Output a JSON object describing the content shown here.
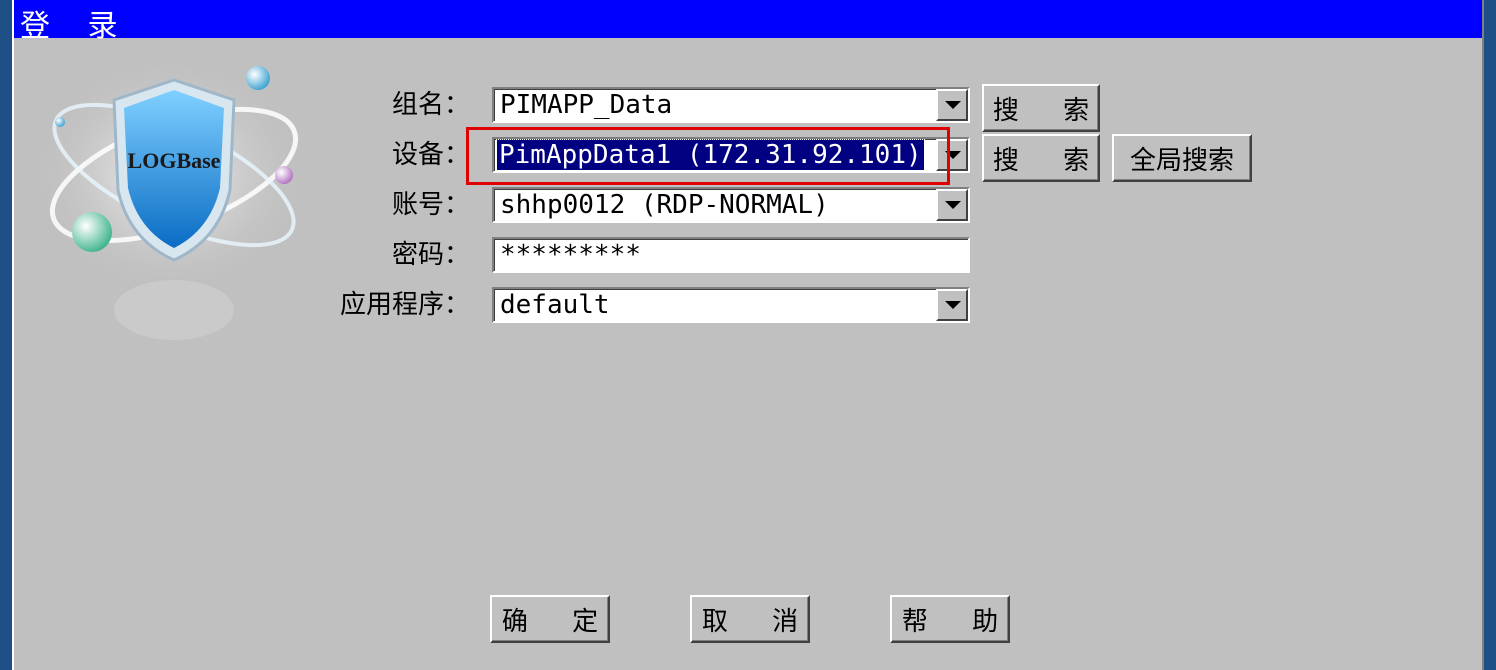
{
  "window": {
    "title": "登 录"
  },
  "logo": {
    "text": "LOGBase"
  },
  "form": {
    "group": {
      "label": "组名：",
      "value": "PIMAPP_Data",
      "search_label": "搜 索"
    },
    "device": {
      "label": "设备：",
      "value": "PimAppData1 (172.31.92.101)",
      "search_label": "搜 索",
      "global_search_label": "全局搜索"
    },
    "account": {
      "label": "账号：",
      "value": "shhp0012 (RDP-NORMAL)"
    },
    "password": {
      "label": "密码：",
      "value": "*********"
    },
    "application": {
      "label": "应用程序：",
      "value": "default"
    }
  },
  "footer": {
    "ok_label": "确 定",
    "cancel_label": "取 消",
    "help_label": "帮 助"
  },
  "colors": {
    "titlebar": "#0000ff",
    "window_bg": "#c0c0c0",
    "selection": "#000080",
    "highlight_box": "#e00000"
  }
}
